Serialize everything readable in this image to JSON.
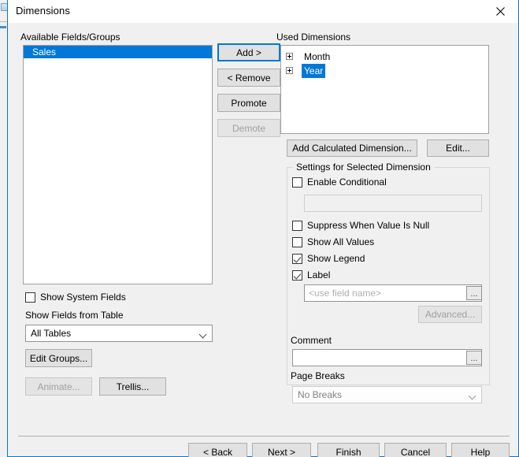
{
  "window": {
    "title": "Dimensions",
    "close_icon": "close-icon"
  },
  "available_fields": {
    "label": "Available Fields/Groups",
    "items": [
      {
        "label": "Sales",
        "selected": true
      }
    ]
  },
  "transfer_buttons": {
    "add": "Add >",
    "remove": "< Remove",
    "promote": "Promote",
    "demote": "Demote"
  },
  "used_dimensions": {
    "label": "Used Dimensions",
    "items": [
      {
        "label": "Month",
        "selected": false,
        "expander": "plus-icon"
      },
      {
        "label": "Year",
        "selected": true,
        "expander": "plus-icon"
      }
    ],
    "add_calculated": "Add Calculated Dimension...",
    "edit": "Edit..."
  },
  "settings": {
    "group_title": "Settings for Selected Dimension",
    "enable_conditional": {
      "label": "Enable Conditional",
      "checked": false
    },
    "conditional_expression": {
      "value": ""
    },
    "suppress_when_null": {
      "label": "Suppress When Value Is Null",
      "checked": false
    },
    "show_all_values": {
      "label": "Show All Values",
      "checked": false
    },
    "show_legend": {
      "label": "Show Legend",
      "checked": true
    },
    "label_cb": {
      "label": "Label",
      "checked": true
    },
    "label_field": {
      "placeholder": "<use field name>",
      "value": ""
    },
    "label_browse": "...",
    "advanced": "Advanced...",
    "comment": {
      "label": "Comment",
      "value": ""
    },
    "comment_browse": "...",
    "page_breaks": {
      "label": "Page Breaks",
      "value": "No Breaks"
    }
  },
  "left_panel": {
    "show_system_fields": {
      "label": "Show System Fields",
      "checked": false
    },
    "show_fields_from_table_label": "Show Fields from Table",
    "table_filter_value": "All Tables",
    "edit_groups": "Edit Groups...",
    "animate": "Animate...",
    "trellis": "Trellis..."
  },
  "footer": {
    "back": "< Back",
    "next": "Next >",
    "finish": "Finish",
    "cancel": "Cancel",
    "help": "Help"
  },
  "colors": {
    "accent": "#0078d7",
    "window_bg": "#f0f0f0",
    "field_bg": "#ffffff",
    "disabled_text": "#a0a0a0"
  }
}
